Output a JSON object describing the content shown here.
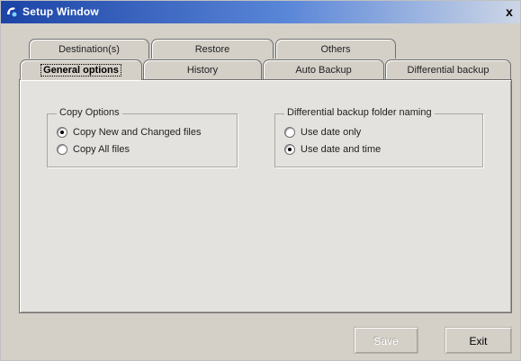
{
  "window": {
    "title": "Setup Window",
    "close_label": "x"
  },
  "tabs": {
    "back_row": [
      {
        "label": "Destination(s)"
      },
      {
        "label": "Restore"
      },
      {
        "label": "Others"
      }
    ],
    "front_row": [
      {
        "label": "General options",
        "active": true
      },
      {
        "label": "History"
      },
      {
        "label": "Auto Backup"
      },
      {
        "label": "Differential backup"
      }
    ]
  },
  "copy_options": {
    "legend": "Copy Options",
    "options": [
      {
        "label": "Copy New and Changed files",
        "checked": true
      },
      {
        "label": "Copy All files",
        "checked": false
      }
    ]
  },
  "diff_naming": {
    "legend": "Differential backup folder naming",
    "options": [
      {
        "label": "Use date only",
        "checked": false
      },
      {
        "label": "Use date and time",
        "checked": true
      }
    ]
  },
  "buttons": {
    "save_label": "Save",
    "save_enabled": false,
    "exit_label": "Exit"
  }
}
